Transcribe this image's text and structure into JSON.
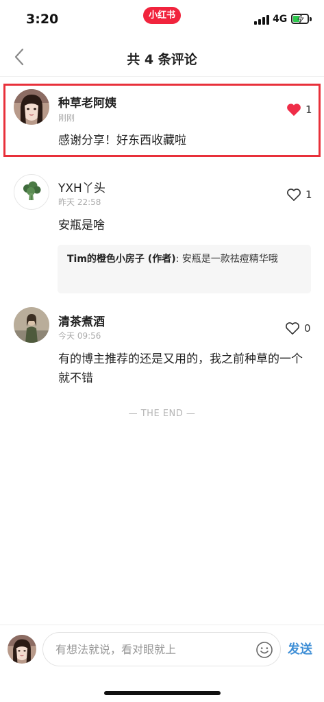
{
  "status_bar": {
    "time": "3:20",
    "app_badge": "小红书",
    "network": "4G",
    "battery_level": 0.4
  },
  "header": {
    "title": "共 4 条评论",
    "back_icon": "chevron-left-icon"
  },
  "comments": [
    {
      "name": "种草老阿姨",
      "time": "刚刚",
      "content": "感谢分享！好东西收藏啦",
      "likes": "1",
      "liked": true,
      "highlighted": true
    },
    {
      "name": "YXH丫头",
      "time": "昨天 22:58",
      "content": "安瓶是啥",
      "likes": "1",
      "liked": false,
      "reply": {
        "author": "Tim的橙色小房子 (作者)",
        "text": ": 安瓶是一款祛痘精华哦"
      }
    },
    {
      "name": "清茶煮酒",
      "time": "今天 09:56",
      "content": "有的博主推荐的还是又用的，我之前种草的一个就不错",
      "likes": "0",
      "liked": false
    }
  ],
  "end_mark": "— THE END —",
  "bottom_bar": {
    "placeholder": "有想法就说，看对眼就上",
    "send_label": "发送"
  },
  "colors": {
    "brand_red": "#f1243d",
    "highlight_border": "#e8303a",
    "send_blue": "#3f8fd6",
    "like_red": "#ef2d48"
  }
}
